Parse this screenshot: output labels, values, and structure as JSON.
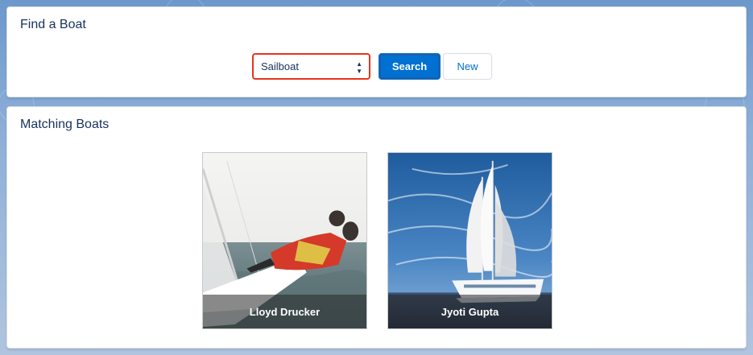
{
  "find_card": {
    "title": "Find a Boat",
    "boat_type_select": {
      "selected": "Sailboat"
    },
    "search_label": "Search",
    "new_label": "New"
  },
  "matching_card": {
    "title": "Matching Boats",
    "boats": [
      {
        "owner": "Lloyd Drucker"
      },
      {
        "owner": "Jyoti Gupta"
      }
    ]
  },
  "colors": {
    "brand_blue": "#0070d2",
    "select_focus_red": "#e8341c",
    "text_dark": "#16325c"
  }
}
